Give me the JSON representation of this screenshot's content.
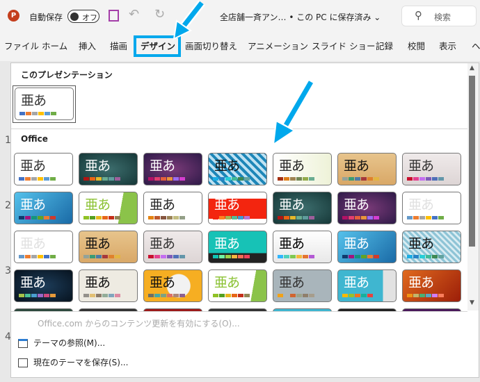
{
  "titlebar": {
    "autosave_label": "自動保存",
    "autosave_state": "オフ",
    "doc_title": "全店舗一斉アン… • この PC に保存済み ⌄",
    "search_placeholder": "検索",
    "logo": "P"
  },
  "ribbon": {
    "tabs": [
      "ファイル",
      "ホーム",
      "挿入",
      "描画",
      "デザイン",
      "画面切り替え",
      "アニメーション",
      "スライド ショー",
      "記録",
      "校閲",
      "表示",
      "ヘ"
    ],
    "active_tab": "デザイン"
  },
  "slide_numbers": [
    "1",
    "2",
    "3",
    "4"
  ],
  "gallery": {
    "this_presentation_label": "このプレゼンテーション",
    "office_label": "Office",
    "sample_text": "亜あ",
    "current_theme": {
      "bg": "#ffffff",
      "fg": "#333333",
      "swatches": [
        "#4472c4",
        "#ed7d31",
        "#a5a5a5",
        "#ffc000",
        "#5b9bd5",
        "#70ad47"
      ]
    },
    "themes": [
      {
        "bg": "#ffffff",
        "fg": "#333",
        "sw": [
          "#4472c4",
          "#ed7d31",
          "#a5a5a5",
          "#ffc000",
          "#5b9bd5",
          "#70ad47"
        ]
      },
      {
        "bg": "radial-gradient(#3d6e6e,#163838)",
        "fg": "#fff",
        "sw": [
          "#b01513",
          "#ea6312",
          "#e6b729",
          "#6aac90",
          "#5f9c9d",
          "#9e5e9b"
        ]
      },
      {
        "bg": "radial-gradient(#7a3a78,#2e1a48)",
        "fg": "#fff",
        "sw": [
          "#b31166",
          "#e33d6f",
          "#e45f3c",
          "#e9943a",
          "#9b6bf2",
          "#d53dd0"
        ]
      },
      {
        "bg": "repeating-linear-gradient(45deg,#1d86b8 0 4px,#bfe2f2 4px 8px)",
        "fg": "#111",
        "sw": [
          "#1cade4",
          "#2683c6",
          "#27ced7",
          "#42ba97",
          "#3e8853",
          "#62a39f"
        ]
      },
      {
        "bg": "linear-gradient(90deg,#fff,#eef2d8)",
        "fg": "#222",
        "sw": [
          "#a53010",
          "#de7e18",
          "#9f8351",
          "#728653",
          "#92aa4c",
          "#6aac91"
        ]
      },
      {
        "bg": "linear-gradient(#e7c48c,#d9a867)",
        "fg": "#111",
        "sw": [
          "#93a299",
          "#3a9b75",
          "#4c7aa5",
          "#a6383b",
          "#e0812b",
          "#e3b541"
        ]
      },
      {
        "bg": "linear-gradient(#efeaea,#ddd5d5)",
        "fg": "#333",
        "sw": [
          "#c8102e",
          "#e3418f",
          "#c46ef0",
          "#7e5bb8",
          "#4f6fb8",
          "#6396a9"
        ]
      },
      {
        "bg": "linear-gradient(135deg,#55c1eb,#1a6aa6)",
        "fg": "#fff",
        "sw": [
          "#0f3a6d",
          "#a1147e",
          "#14957d",
          "#62a324",
          "#ee7b30",
          "#d13a2c"
        ]
      },
      {
        "bg": "linear-gradient(100deg,#fff 70%,#8bc34a 70%)",
        "fg": "#8ac132",
        "sw": [
          "#90c226",
          "#54a021",
          "#e6b91e",
          "#e76618",
          "#c42f1a",
          "#918655"
        ]
      },
      {
        "bg": "#ffffff",
        "fg": "#222",
        "sw": [
          "#e48312",
          "#bd582c",
          "#865640",
          "#9b8357",
          "#c2bc80",
          "#94a088"
        ]
      },
      {
        "bg": "linear-gradient(#fff 20%,#f3250f 20% 85%,#fff 85%)",
        "fg": "#fff",
        "sw": [
          "#f3250f",
          "#ff8021",
          "#a5b552",
          "#54bd97",
          "#3d9bd7",
          "#b772d6"
        ]
      },
      {
        "bg": "radial-gradient(#3d6e6e,#163838)",
        "fg": "#fff",
        "sw": [
          "#b01513",
          "#ea6312",
          "#e6b729",
          "#6aac90",
          "#5f9c9d",
          "#9e5e9b"
        ]
      },
      {
        "bg": "radial-gradient(#7a3a78,#2e1a48)",
        "fg": "#fff",
        "sw": [
          "#b31166",
          "#e33d6f",
          "#e45f3c",
          "#e9943a",
          "#9b6bf2",
          "#d53dd0"
        ]
      },
      {
        "bg": "#ffffff",
        "fg": "#e0e0e0",
        "sw": [
          "#6599c9",
          "#ed7d31",
          "#a5a5a5",
          "#ffc000",
          "#4472c4",
          "#70ad47"
        ]
      },
      {
        "bg": "#ffffff",
        "fg": "#e0e0e0",
        "sw": [
          "#6599c9",
          "#ed7d31",
          "#a5a5a5",
          "#ffc000",
          "#4472c4",
          "#70ad47"
        ]
      },
      {
        "bg": "linear-gradient(#e7c48c,#d9a867)",
        "fg": "#111",
        "sw": [
          "#93a299",
          "#3a9b75",
          "#4c7aa5",
          "#a6383b",
          "#e0812b",
          "#e3b541"
        ]
      },
      {
        "bg": "linear-gradient(#efeaea,#ddd5d5)",
        "fg": "#333",
        "sw": [
          "#c8102e",
          "#e3418f",
          "#c46ef0",
          "#7e5bb8",
          "#4f6fb8",
          "#6396a9"
        ]
      },
      {
        "bg": "linear-gradient(#17c2b6 70%,#222 70%)",
        "fg": "#fff",
        "sw": [
          "#10c5b5",
          "#6ff3a4",
          "#9bd24c",
          "#f3b53f",
          "#f56b53",
          "#f0425a"
        ]
      },
      {
        "bg": "linear-gradient(#fff,#e8e8e8)",
        "fg": "#000",
        "sw": [
          "#31b6fd",
          "#4fd1bc",
          "#7ec850",
          "#f4b83c",
          "#e4752f",
          "#b359d4"
        ]
      },
      {
        "bg": "linear-gradient(135deg,#55c1eb,#1a6aa6)",
        "fg": "#fff",
        "sw": [
          "#0f3a6d",
          "#a1147e",
          "#14957d",
          "#62a324",
          "#ee7b30",
          "#d13a2c"
        ]
      },
      {
        "bg": "repeating-linear-gradient(45deg,#8ec4d6 0 3px,#d9ecf2 3px 6px)",
        "fg": "#111",
        "sw": [
          "#1cade4",
          "#2683c6",
          "#27ced7",
          "#42ba97",
          "#3e8853",
          "#62a39f"
        ]
      },
      {
        "bg": "radial-gradient(#1d3d5a,#07131f)",
        "fg": "#fff",
        "sw": [
          "#a5c249",
          "#49c098",
          "#4a9ed1",
          "#9b67c8",
          "#d0497f",
          "#e79a3a"
        ]
      },
      {
        "bg": "#eeebe2",
        "fg": "#111",
        "sw": [
          "#94918b",
          "#e2c074",
          "#8c7c6a",
          "#93ad98",
          "#81a5bd",
          "#de8ba3"
        ]
      },
      {
        "bg": "radial-gradient(circle at 60% 50%,#f2f2f2 30%,#f6ae22 32%)",
        "fg": "#111",
        "sw": [
          "#6f6f64",
          "#45a9a6",
          "#7ea282",
          "#dd7165",
          "#ad8677",
          "#8c6191"
        ]
      },
      {
        "bg": "linear-gradient(100deg,#fff 75%,#8bc34a 75%)",
        "fg": "#8ac132",
        "sw": [
          "#90c226",
          "#54a021",
          "#e6b91e",
          "#e76618",
          "#c42f1a",
          "#918655"
        ]
      },
      {
        "bg": "#a9b5bb",
        "fg": "#333",
        "sw": [
          "#f2a218",
          "#a9b5bb",
          "#d06530",
          "#9ca48a",
          "#8f7f6b",
          "#a69d8c"
        ]
      },
      {
        "bg": "linear-gradient(90deg,#3fb6d0 78%,#e2e2e2 78%)",
        "fg": "#fff",
        "sw": [
          "#fcb900",
          "#9bc02a",
          "#f2721f",
          "#16b09c",
          "#e8433f"
        ]
      },
      {
        "bg": "linear-gradient(135deg,#e06a1e,#9c1e09)",
        "fg": "#fff",
        "sw": [
          "#f09415",
          "#c1b56b",
          "#4baf73",
          "#5aa6c0",
          "#d17df9",
          "#fa7e5c"
        ]
      },
      {
        "bg": "#2e4a3e",
        "fg": "#fff",
        "sw": []
      },
      {
        "bg": "#333",
        "fg": "#fff",
        "sw": []
      },
      {
        "bg": "#9c1a1a",
        "fg": "#fff",
        "sw": []
      },
      {
        "bg": "#333",
        "fg": "#fff",
        "sw": []
      },
      {
        "bg": "#3fb6d0",
        "fg": "#fff",
        "sw": []
      },
      {
        "bg": "#222",
        "fg": "#fff",
        "sw": []
      },
      {
        "bg": "#4a1a5a",
        "fg": "#fff",
        "sw": []
      }
    ]
  },
  "menu": {
    "update_label": "Office.com からのコンテンツ更新を有効にする(O)...",
    "browse_label": "テーマの参照(M)...",
    "save_label": "現在のテーマを保存(S)..."
  },
  "colors": {
    "accent_arrow": "#00a8ec",
    "active_tab_underline": "#b7472a"
  }
}
